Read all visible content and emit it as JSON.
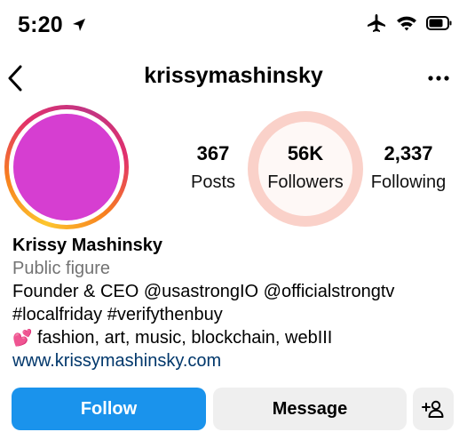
{
  "status_bar": {
    "time": "5:20",
    "icons": [
      "location-arrow-icon",
      "airplane-icon",
      "wifi-icon",
      "battery-icon"
    ]
  },
  "header": {
    "username": "krissymashinsky",
    "back_icon": "chevron-left-icon",
    "more_icon": "more-horizontal-icon"
  },
  "profile": {
    "avatar_color": "#d63ed1",
    "stats": [
      {
        "value": "367",
        "label": "Posts"
      },
      {
        "value": "56K",
        "label": "Followers"
      },
      {
        "value": "2,337",
        "label": "Following"
      }
    ],
    "name": "Krissy Mashinsky",
    "category": "Public figure",
    "bio_lines": [
      "Founder & CEO @usastrongIO @officialstrongtv",
      "#localfriday #verifythenbuy",
      "fashion, art, music, blockchain, webIII"
    ],
    "bio_emoji": "💕",
    "website": "www.krissymashinsky.com"
  },
  "actions": {
    "follow_label": "Follow",
    "message_label": "Message",
    "add_user_icon": "add-user-icon"
  },
  "colors": {
    "follow_button": "#1a93ec",
    "secondary_button": "#efefef",
    "link": "#00376b",
    "category_text": "#737373"
  }
}
